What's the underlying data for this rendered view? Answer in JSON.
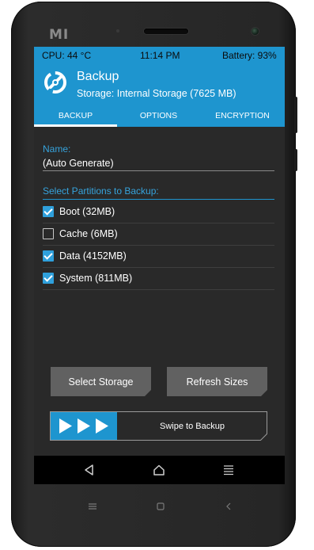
{
  "device": {
    "brand_logo": "MI",
    "capacitive_keys": [
      "menu-icon",
      "home-icon",
      "back-icon"
    ]
  },
  "status_bar": {
    "cpu": "CPU: 44 °C",
    "time": "11:14 PM",
    "battery": "Battery: 93%"
  },
  "header": {
    "logo": "twrp-logo-icon",
    "title": "Backup",
    "storage": "Storage: Internal Storage (7625 MB)"
  },
  "tabs": [
    {
      "label": "BACKUP",
      "active": true
    },
    {
      "label": "OPTIONS",
      "active": false
    },
    {
      "label": "ENCRYPTION",
      "active": false
    }
  ],
  "name_field": {
    "label": "Name:",
    "value": "(Auto Generate)"
  },
  "partitions": {
    "label": "Select Partitions to Backup:",
    "items": [
      {
        "label": "Boot (32MB)",
        "checked": true
      },
      {
        "label": "Cache (6MB)",
        "checked": false
      },
      {
        "label": "Data (4152MB)",
        "checked": true
      },
      {
        "label": "System (811MB)",
        "checked": true
      }
    ]
  },
  "buttons": {
    "select_storage": "Select Storage",
    "refresh_sizes": "Refresh Sizes"
  },
  "swipe": {
    "label": "Swipe to Backup",
    "icon": "triple-arrow-right-icon"
  },
  "navbar": {
    "icons": [
      "back-triangle-icon",
      "home-icon",
      "menu-icon"
    ]
  },
  "colors": {
    "accent": "#1e95cf",
    "screen_bg": "#292929",
    "button_bg": "#616161",
    "navbar_bg": "#000000"
  }
}
